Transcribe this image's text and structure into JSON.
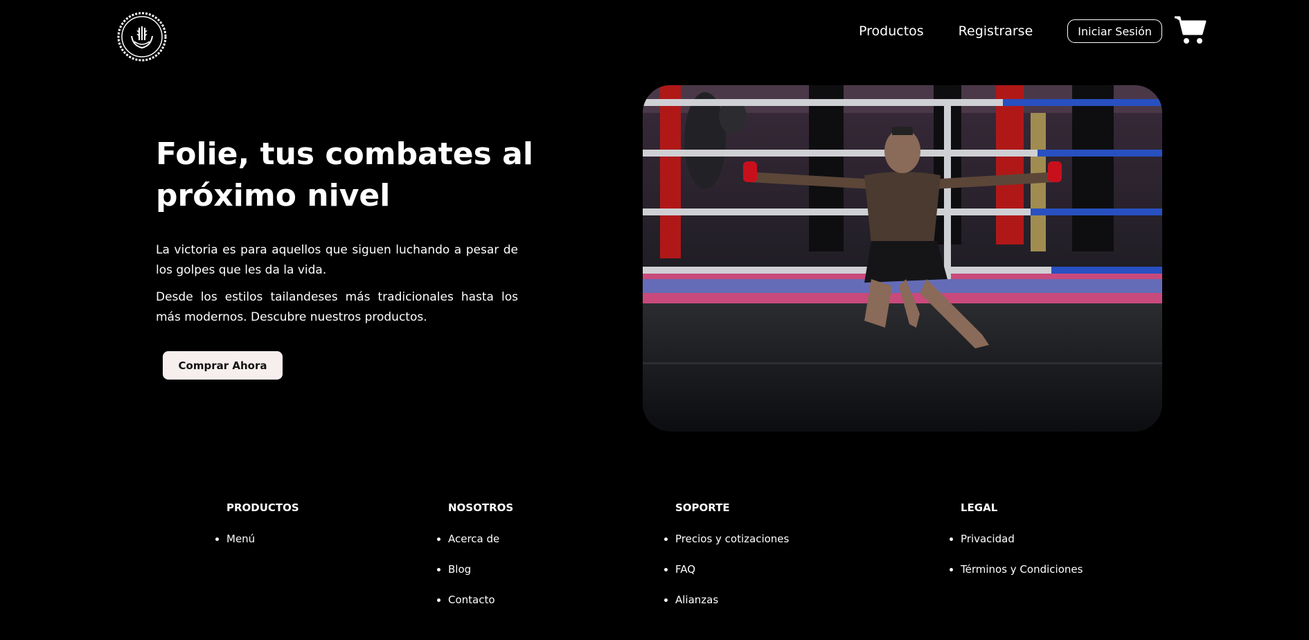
{
  "header": {
    "logo_icon": "wheat-laurel-logo-icon",
    "nav": {
      "products_label": "Productos",
      "register_label": "Registrarse",
      "login_label": "Iniciar Sesión"
    },
    "cart_icon": "shopping-cart-icon"
  },
  "hero": {
    "title": "Folie, tus combates al próximo nivel",
    "paragraph_1": "La victoria es para aquellos que siguen luchando a pesar de los golpes que les da la vida.",
    "paragraph_2": "Desde los estilos tailandeses más tradicionales hasta los más modernos. Descubre nuestros productos.",
    "cta_label": "Comprar Ahora"
  },
  "footer": {
    "columns": [
      {
        "heading": "PRODUCTOS",
        "items": [
          "Menú"
        ]
      },
      {
        "heading": "NOSOTROS",
        "items": [
          "Acerca de",
          "Blog",
          "Contacto"
        ]
      },
      {
        "heading": "SOPORTE",
        "items": [
          "Precios y cotizaciones",
          "FAQ",
          "Alianzas"
        ]
      },
      {
        "heading": "LEGAL",
        "items": [
          "Privacidad",
          "Términos y Condiciones"
        ]
      }
    ]
  },
  "colors": {
    "background": "#000000",
    "text": "#ffffff",
    "cta_background": "#f7eeee"
  }
}
